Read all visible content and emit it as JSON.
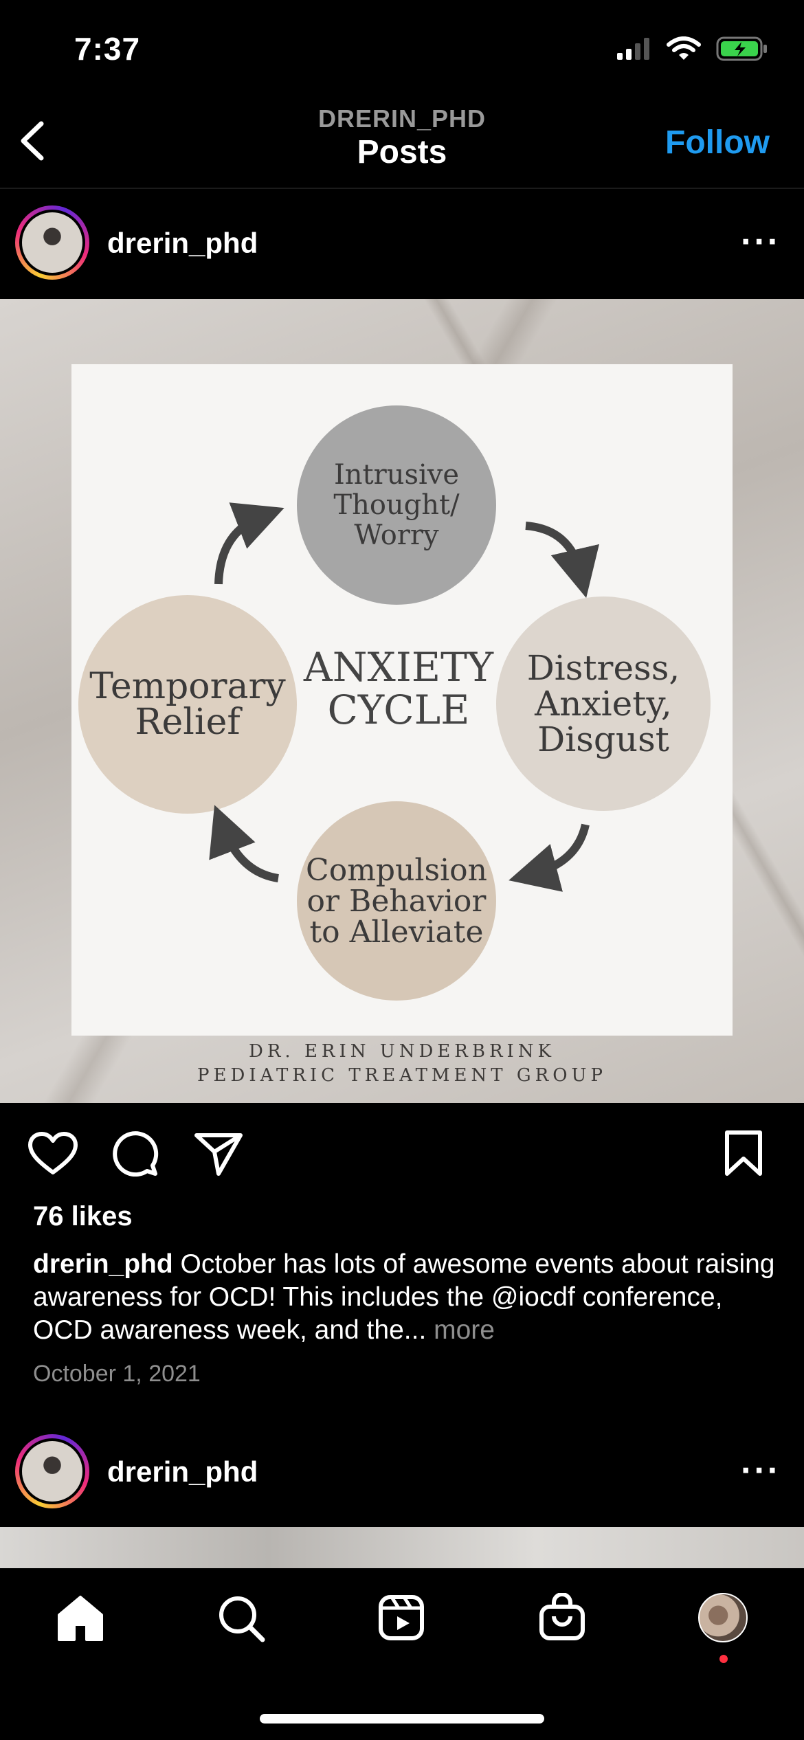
{
  "status_bar": {
    "time": "7:37"
  },
  "header": {
    "username": "DRERIN_PHD",
    "title": "Posts",
    "follow_label": "Follow"
  },
  "post": {
    "username": "drerin_phd",
    "image": {
      "cycle_title_line1": "ANXIETY",
      "cycle_title_line2": "CYCLE",
      "top_node": [
        "Intrusive",
        "Thought/",
        "Worry"
      ],
      "right_node": [
        "Distress,",
        "Anxiety,",
        "Disgust"
      ],
      "bottom_node": [
        "Compulsion",
        "or Behavior",
        "to Alleviate"
      ],
      "left_node": [
        "Temporary",
        "Relief"
      ],
      "credit_line1": "DR. ERIN UNDERBRINK",
      "credit_line2": "PEDIATRIC TREATMENT GROUP"
    },
    "likes": "76 likes",
    "caption_user": "drerin_phd",
    "caption_text": " October has lots of awesome events about raising awareness for OCD! This includes the @iocdf conference, OCD awareness week, and the...",
    "caption_more": " more",
    "date": "October 1, 2021"
  },
  "next_post": {
    "username": "drerin_phd"
  },
  "icons": {
    "back": "chevron-left-icon",
    "like": "heart-icon",
    "comment": "comment-icon",
    "share": "paper-plane-icon",
    "save": "bookmark-icon",
    "home": "home-icon",
    "search": "search-icon",
    "reels": "reels-icon",
    "shop": "shop-bag-icon",
    "profile": "profile-avatar"
  },
  "colors": {
    "accent": "#1f9bf0",
    "notification": "#ff3040"
  }
}
